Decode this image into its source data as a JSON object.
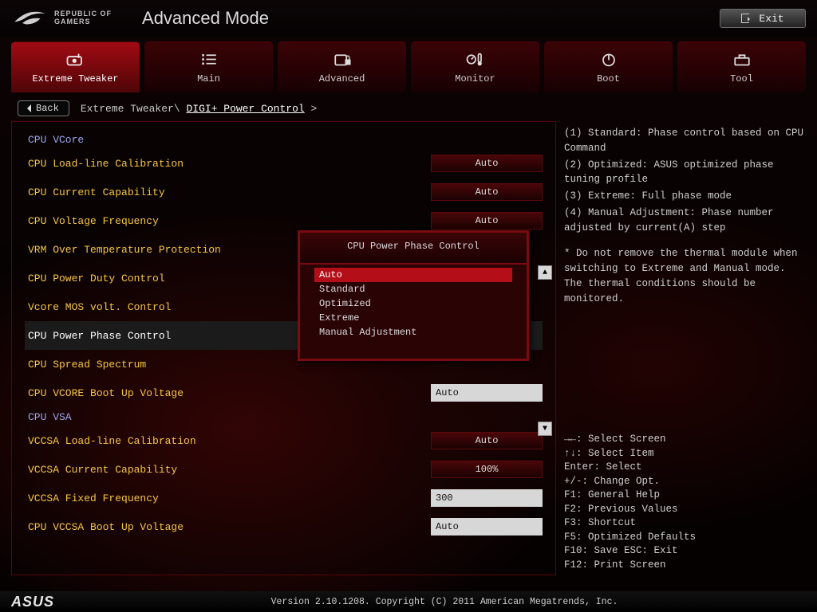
{
  "header": {
    "brand_line1": "REPUBLIC OF",
    "brand_line2": "GAMERS",
    "page_title": "Advanced Mode",
    "exit_label": "Exit"
  },
  "tabs": [
    {
      "label": "Extreme Tweaker",
      "icon": "tweaker-icon",
      "active": true
    },
    {
      "label": "Main",
      "icon": "list-icon"
    },
    {
      "label": "Advanced",
      "icon": "chip-lock-icon"
    },
    {
      "label": "Monitor",
      "icon": "thermo-icon"
    },
    {
      "label": "Boot",
      "icon": "power-icon"
    },
    {
      "label": "Tool",
      "icon": "toolbox-icon"
    }
  ],
  "breadcrumb": {
    "back_label": "Back",
    "root": "Extreme Tweaker",
    "current": "DIGI+ Power Control",
    "sep1": "\\",
    "sep2": ">"
  },
  "settings": [
    {
      "type": "section",
      "label": "CPU VCore"
    },
    {
      "type": "dropdown",
      "label": "CPU Load-line Calibration",
      "value": "Auto"
    },
    {
      "type": "dropdown",
      "label": "CPU Current Capability",
      "value": "Auto"
    },
    {
      "type": "dropdown",
      "label": "CPU Voltage Frequency",
      "value": "Auto"
    },
    {
      "type": "dropdown",
      "label": "VRM Over Temperature Protection",
      "value": ""
    },
    {
      "type": "dropdown",
      "label": "CPU Power Duty Control",
      "value": ""
    },
    {
      "type": "dropdown",
      "label": "Vcore MOS volt. Control",
      "value": ""
    },
    {
      "type": "dropdown",
      "label": "CPU Power Phase Control",
      "value": "",
      "selected": true
    },
    {
      "type": "dropdown",
      "label": "CPU Spread Spectrum",
      "value": ""
    },
    {
      "type": "input",
      "label": "CPU VCORE Boot Up Voltage",
      "value": "Auto"
    },
    {
      "type": "section",
      "label": "CPU VSA"
    },
    {
      "type": "dropdown",
      "label": "VCCSA Load-line Calibration",
      "value": "Auto"
    },
    {
      "type": "dropdown",
      "label": "VCCSA Current Capability",
      "value": "100%"
    },
    {
      "type": "input",
      "label": "VCCSA Fixed Frequency",
      "value": "300"
    },
    {
      "type": "input",
      "label": "CPU VCCSA Boot Up Voltage",
      "value": "Auto"
    }
  ],
  "popup": {
    "title": "CPU Power Phase Control",
    "options": [
      "Auto",
      "Standard",
      "Optimized",
      "Extreme",
      "Manual Adjustment"
    ],
    "selected_index": 0
  },
  "help": {
    "lines": [
      "(1) Standard: Phase control based on CPU Command",
      "(2) Optimized: ASUS optimized phase tuning profile",
      "(3) Extreme: Full phase mode",
      "(4) Manual Adjustment: Phase number adjusted by current(A) step"
    ],
    "note": "* Do not remove the thermal module when switching to Extreme and Manual mode. The thermal conditions should be monitored."
  },
  "keyhelp": [
    "→←: Select Screen",
    "↑↓: Select Item",
    "Enter: Select",
    "+/-: Change Opt.",
    "F1: General Help",
    "F2: Previous Values",
    "F3: Shortcut",
    "F5: Optimized Defaults",
    "F10: Save  ESC: Exit",
    "F12: Print Screen"
  ],
  "footer": {
    "vendor": "ASUS",
    "version": "Version 2.10.1208. Copyright (C) 2011 American Megatrends, Inc."
  }
}
